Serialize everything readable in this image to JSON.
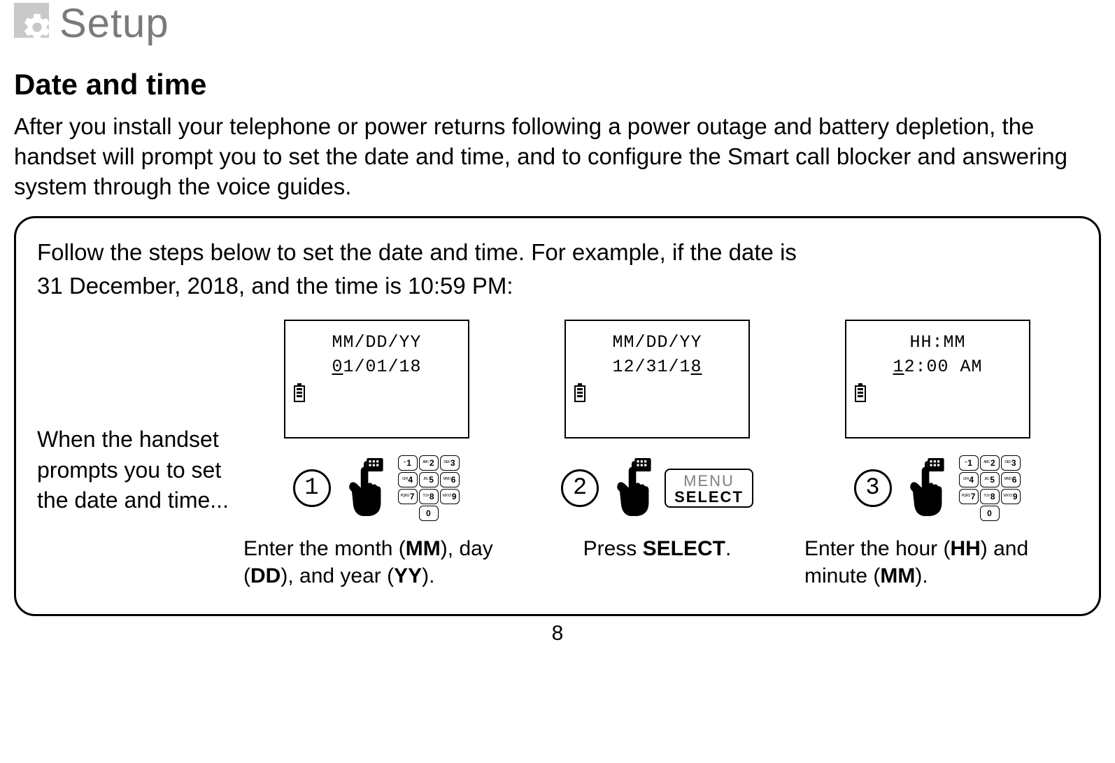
{
  "header": {
    "chapter": "Setup"
  },
  "title": "Date and time",
  "intro": "After you install your telephone or power returns following a power outage and battery depletion, the handset will prompt you to set the date and time, and to configure the Smart call blocker and answering system through the voice guides.",
  "box": {
    "lead_in_1": "Follow the steps below to set the date and time. For example, if the date is",
    "lead_in_2": "31 December, 2018, and the time is 10:59 PM:",
    "prompt": "When the handset prompts you to set the date and time...",
    "steps": [
      {
        "num": "1",
        "lcd_line1": "MM/DD/YY",
        "lcd_line2_pre": "0",
        "lcd_line2_rest": "1/01/18",
        "underline": "first",
        "caption_parts": [
          "Enter the month (",
          "MM",
          "), day (",
          "DD",
          "), and year (",
          "YY",
          ")."
        ],
        "show_keypad": true,
        "show_menu_select": false
      },
      {
        "num": "2",
        "lcd_line1": "MM/DD/YY",
        "lcd_line2_pre": "12/31/1",
        "lcd_line2_rest": "8",
        "underline": "last",
        "caption_parts": [
          "Press ",
          "SELECT",
          "."
        ],
        "show_keypad": false,
        "show_menu_select": true,
        "menu_label": "MENU",
        "select_label": "SELECT"
      },
      {
        "num": "3",
        "lcd_line1": "HH:MM",
        "lcd_line2_pre": "1",
        "lcd_line2_rest": "2:00 AM",
        "underline": "first",
        "caption_parts": [
          "Enter the hour (",
          "HH",
          ") and minute (",
          "MM",
          ")."
        ],
        "show_keypad": true,
        "show_menu_select": false
      }
    ]
  },
  "keypad": {
    "keys": [
      {
        "sub": "∞",
        "num": "1"
      },
      {
        "sub": "ABC",
        "num": "2"
      },
      {
        "sub": "DEF",
        "num": "3"
      },
      {
        "sub": "GHI",
        "num": "4"
      },
      {
        "sub": "JKL",
        "num": "5"
      },
      {
        "sub": "MNO",
        "num": "6"
      },
      {
        "sub": "PQRS",
        "num": "7"
      },
      {
        "sub": "TUV",
        "num": "8"
      },
      {
        "sub": "WXYZ",
        "num": "9"
      }
    ],
    "zero": {
      "sub": "",
      "num": "0"
    }
  },
  "page_number": "8"
}
